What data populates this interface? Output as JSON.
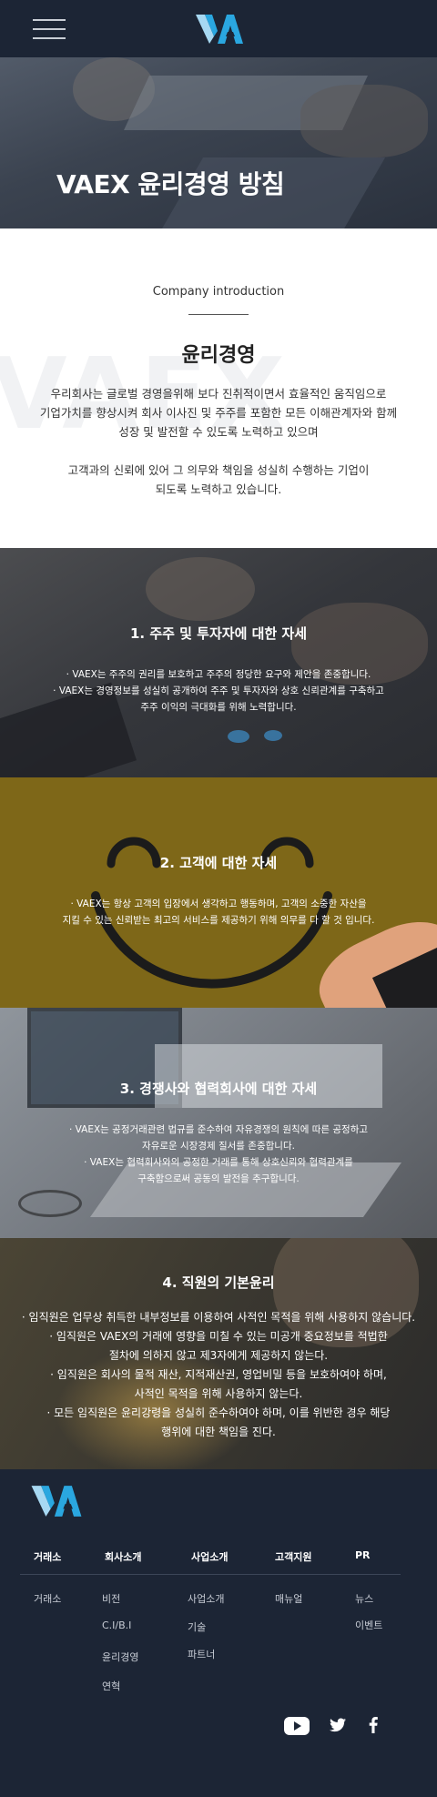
{
  "header": {
    "menu_icon": "hamburger-menu-icon",
    "logo_icon": "vaex-logo"
  },
  "hero": {
    "title": "VAEX 윤리경영 방침"
  },
  "intro": {
    "eyebrow": "Company introduction",
    "bg_word": "VAEX",
    "heading": "윤리경영",
    "paragraph1_lines": [
      "우리회사는 글로벌 경영을위해 보다 진취적이면서 효율적인 움직임으로",
      "기업가치를 향상시켜 회사 이사진 및 주주를 포함한 모든 이해관계자와 함께",
      "성장 및 발전할 수 있도록 노력하고  있으며"
    ],
    "paragraph2_lines": [
      "고객과의 신뢰에 있어 그 의무와 책임을 성실히 수행하는 기업이",
      "되도록 노력하고 있습니다."
    ]
  },
  "sections": [
    {
      "title": "1. 주주 및 투자자에 대한 자세",
      "lines": [
        "· VAEX는 주주의 권리를 보호하고 주주의 정당한 요구와 제안을 존중합니다.",
        "· VAEX는 경영정보를 성실히 공개하여 주주 및 투자자와 상호 신뢰관계를 구축하고",
        "주주 이익의 극대화를 위해 노력합니다."
      ]
    },
    {
      "title": "2. 고객에 대한 자세",
      "lines": [
        "· VAEX는 항상 고객의 입장에서 생각하고 행동하며, 고객의 소중한 자산을",
        "지킬 수 있는 신뢰받는 최고의 서비스를 제공하기 위해 의무를 다 할 것 입니다."
      ]
    },
    {
      "title": "3. 경쟁사와 협력회사에 대한 자세",
      "lines": [
        "· VAEX는 공정거래관련 법규를 준수하여 자유경쟁의 원칙에 따른 공정하고",
        "자유로운 시장경제 질서를 존중합니다.",
        "· VAEX는 협력회사와의 공정한 거래를 통해 상호신뢰와 협력관계를",
        "구축함으로써 공동의 발전을 추구합니다."
      ]
    },
    {
      "title": "4. 직원의 기본윤리",
      "lines": [
        "· 임직원은 업무상 취득한 내부정보를 이용하여 사적인 목적을 위해 사용하지 않습니다.",
        "· 임직원은 VAEX의 거래에 영향을 미칠 수 있는 미공개 중요정보를 적법한",
        "절차에 의하지 않고 제3자에게 제공하지 않는다.",
        "· 임직원은 회사의 물적 재산, 지적재산권, 영업비밀 등을 보호하여야 하며,",
        "사적인 목적을 위해 사용하지 않는다.",
        "· 모든 임직원은 윤리강령을 성실히 준수하여야 하며, 이를 위반한 경우 해당",
        "행위에 대한 책임을 진다."
      ]
    }
  ],
  "footer": {
    "logo_icon": "vaex-logo",
    "columns": [
      {
        "heading": "거래소",
        "links": [
          "거래소"
        ]
      },
      {
        "heading": "회사소개",
        "links": [
          "비전",
          "C.I/B.I",
          "윤리경영",
          "연혁"
        ]
      },
      {
        "heading": "사업소개",
        "links": [
          "사업소개",
          "기술",
          "파트너"
        ]
      },
      {
        "heading": "고객지원",
        "links": [
          "매뉴얼"
        ]
      },
      {
        "heading": "PR",
        "links": [
          "뉴스",
          "이벤트"
        ]
      }
    ],
    "social_icons": [
      "youtube-icon",
      "twitter-icon",
      "facebook-icon"
    ]
  },
  "colors": {
    "navy": "#1c2535",
    "logo_blue": "#2aa7e0",
    "logo_light": "#a7d8f2",
    "mustard": "#7e6718"
  }
}
